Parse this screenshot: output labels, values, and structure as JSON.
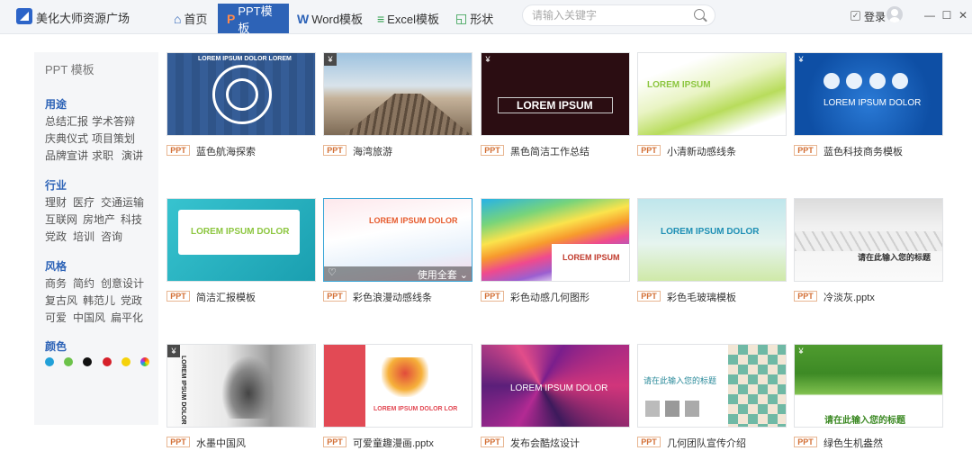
{
  "app": {
    "title": "美化大师资源广场"
  },
  "tabs": [
    {
      "label": "首页",
      "icon": "home-icon"
    },
    {
      "label": "PPT模板",
      "icon": "ppt-icon"
    },
    {
      "label": "Word模板",
      "icon": "word-icon"
    },
    {
      "label": "Excel模板",
      "icon": "excel-icon"
    },
    {
      "label": "形状",
      "icon": "shape-icon"
    }
  ],
  "search": {
    "placeholder": "请输入关键字",
    "value": ""
  },
  "user": {
    "login_label": "登录"
  },
  "sidebar": {
    "title": "PPT 模板",
    "sections": [
      {
        "heading": "用途",
        "items": [
          "总结汇报",
          "学术答辩",
          "庆典仪式",
          "项目策划",
          "品牌宣讲",
          "求职",
          "演讲"
        ]
      },
      {
        "heading": "行业",
        "items": [
          "理财",
          "医疗",
          "交通运输",
          "互联网",
          "房地产",
          "科技",
          "党政",
          "培训",
          "咨询"
        ]
      },
      {
        "heading": "风格",
        "items": [
          "商务",
          "简约",
          "创意设计",
          "复古风",
          "韩范儿",
          "党政",
          "可爱",
          "中国风",
          "扁平化"
        ]
      },
      {
        "heading": "颜色",
        "colors": [
          "#21a0d8",
          "#6cc24a",
          "#111111",
          "#d6202a",
          "#f5d20a",
          "rainbow"
        ]
      }
    ]
  },
  "badge_label": "PPT",
  "templates": [
    {
      "title": "蓝色航海探索",
      "thumb_text": "LOREM IPSUM DOLOR LOREM",
      "price_tag": ""
    },
    {
      "title": "海湾旅游",
      "thumb_text": "",
      "price_tag": "¥"
    },
    {
      "title": "黑色简洁工作总结",
      "thumb_text": "LOREM IPSUM",
      "price_tag": "¥"
    },
    {
      "title": "小清新动感线条",
      "thumb_text": "LOREM IPSUM",
      "price_tag": ""
    },
    {
      "title": "蓝色科技商务模板",
      "thumb_text": "LOREM IPSUM DOLOR",
      "price_tag": "¥"
    },
    {
      "title": "简洁汇报模板",
      "thumb_text": "LOREM IPSUM DOLOR",
      "price_tag": ""
    },
    {
      "title": "彩色浪漫动感线条",
      "thumb_text": "LOREM IPSUM DOLOR",
      "price_tag": "",
      "hover_label": "使用全套"
    },
    {
      "title": "彩色动感几何图形",
      "thumb_text": "LOREM IPSUM",
      "price_tag": ""
    },
    {
      "title": "彩色毛玻璃模板",
      "thumb_text": "LOREM IPSUM DOLOR",
      "price_tag": ""
    },
    {
      "title": "冷淡灰.pptx",
      "thumb_text": "请在此输入您的标题",
      "price_tag": ""
    },
    {
      "title": "水墨中国风",
      "thumb_text": "LOREM IPSUM DOLOR",
      "price_tag": "¥"
    },
    {
      "title": "可爱童趣漫画.pptx",
      "thumb_text": "LOREM IPSUM DOLOR LOR",
      "price_tag": ""
    },
    {
      "title": "发布会酷炫设计",
      "thumb_text": "LOREM IPSUM DOLOR",
      "price_tag": ""
    },
    {
      "title": "几何团队宣传介绍",
      "thumb_text": "请在此输入您的标题",
      "price_tag": ""
    },
    {
      "title": "绿色生机盎然",
      "thumb_text": "请在此输入您的标题",
      "price_tag": "¥"
    }
  ]
}
